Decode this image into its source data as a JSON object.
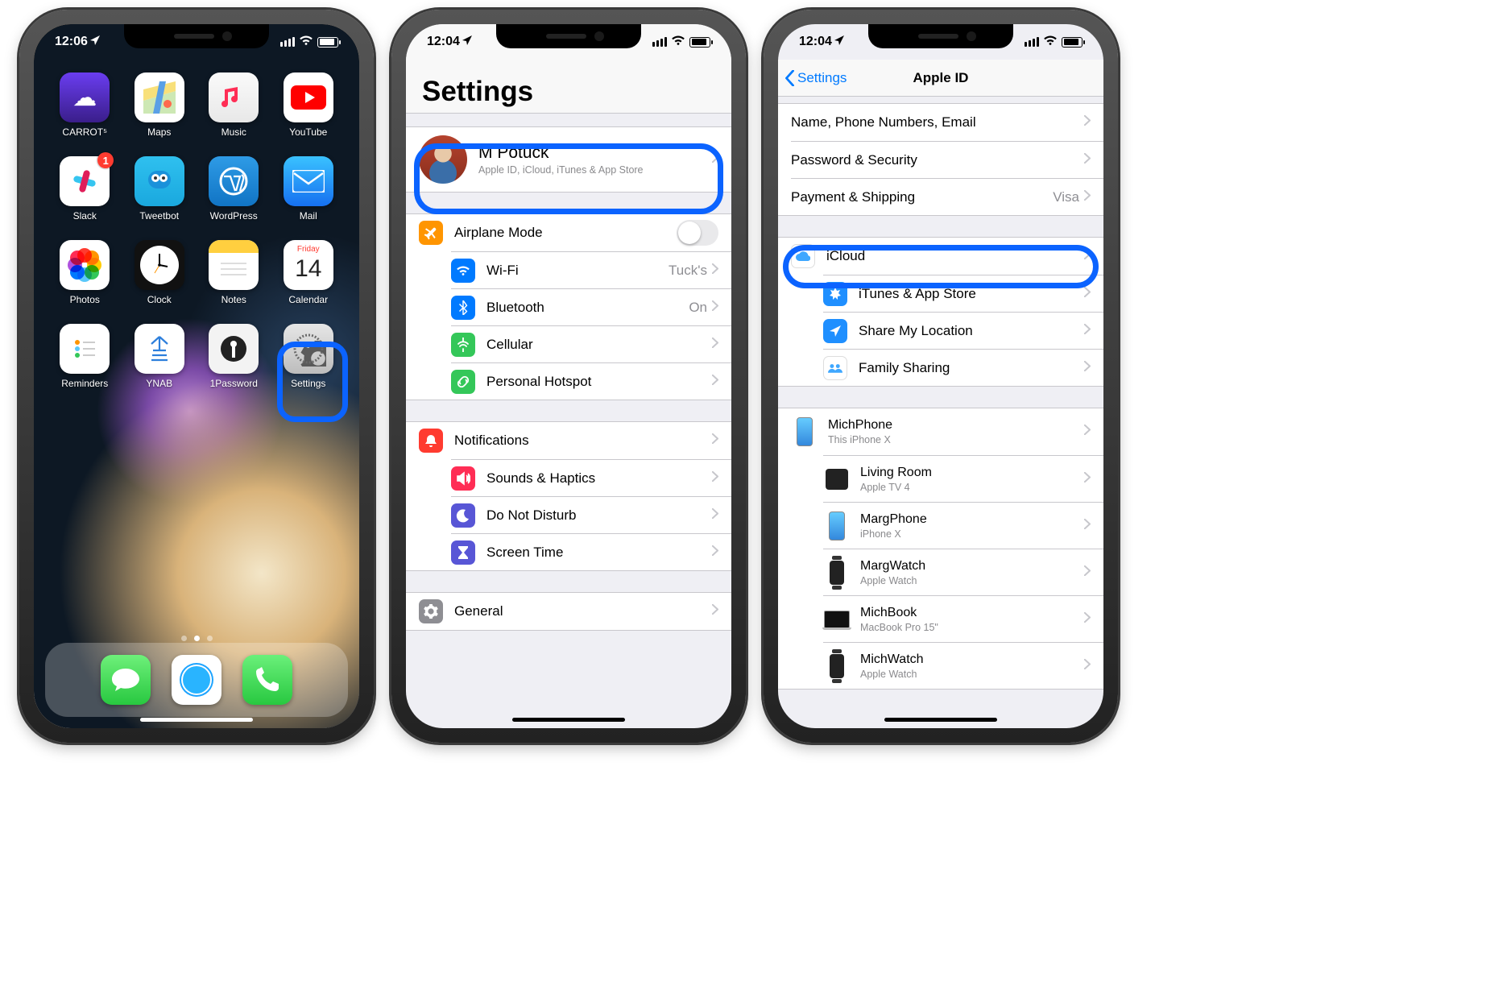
{
  "phone1": {
    "time": "12:06",
    "apps": [
      {
        "id": "carrot",
        "label": "CARROT⁵"
      },
      {
        "id": "maps",
        "label": "Maps"
      },
      {
        "id": "music",
        "label": "Music"
      },
      {
        "id": "youtube",
        "label": "YouTube"
      },
      {
        "id": "slack",
        "label": "Slack",
        "badge": "1"
      },
      {
        "id": "tweetbot",
        "label": "Tweetbot"
      },
      {
        "id": "wordpress",
        "label": "WordPress"
      },
      {
        "id": "mail",
        "label": "Mail"
      },
      {
        "id": "photos",
        "label": "Photos"
      },
      {
        "id": "clock",
        "label": "Clock"
      },
      {
        "id": "notes",
        "label": "Notes"
      },
      {
        "id": "calendar",
        "label": "Calendar",
        "weekday": "Friday",
        "day": "14"
      },
      {
        "id": "reminders",
        "label": "Reminders"
      },
      {
        "id": "ynab",
        "label": "YNAB"
      },
      {
        "id": "1password",
        "label": "1Password"
      },
      {
        "id": "settings",
        "label": "Settings"
      }
    ],
    "dock": [
      "messages",
      "safari",
      "phone"
    ]
  },
  "phone2": {
    "time": "12:04",
    "title": "Settings",
    "profile": {
      "name": "M Potuck",
      "subtitle": "Apple ID, iCloud, iTunes & App Store"
    },
    "group1": [
      {
        "icon": "airplane",
        "label": "Airplane Mode",
        "control": "switch"
      },
      {
        "icon": "wifi",
        "label": "Wi-Fi",
        "value": "Tuck's"
      },
      {
        "icon": "bt",
        "label": "Bluetooth",
        "value": "On"
      },
      {
        "icon": "cell",
        "label": "Cellular"
      },
      {
        "icon": "hotspot",
        "label": "Personal Hotspot"
      }
    ],
    "group2": [
      {
        "icon": "notif",
        "label": "Notifications"
      },
      {
        "icon": "sound",
        "label": "Sounds & Haptics"
      },
      {
        "icon": "dnd",
        "label": "Do Not Disturb"
      },
      {
        "icon": "screentime",
        "label": "Screen Time"
      }
    ],
    "group3": [
      {
        "icon": "general",
        "label": "General"
      }
    ]
  },
  "phone3": {
    "time": "12:04",
    "back": "Settings",
    "title": "Apple ID",
    "group1": [
      {
        "label": "Name, Phone Numbers, Email"
      },
      {
        "label": "Password & Security"
      },
      {
        "label": "Payment & Shipping",
        "value": "Visa"
      }
    ],
    "group2": [
      {
        "icon": "icloud",
        "label": "iCloud"
      },
      {
        "icon": "itunes",
        "label": "iTunes & App Store"
      },
      {
        "icon": "share",
        "label": "Share My Location"
      },
      {
        "icon": "family",
        "label": "Family Sharing"
      }
    ],
    "devices": [
      {
        "kind": "phone",
        "name": "MichPhone",
        "model": "This iPhone X"
      },
      {
        "kind": "atv",
        "name": "Living Room",
        "model": "Apple TV 4"
      },
      {
        "kind": "phone",
        "name": "MargPhone",
        "model": "iPhone X"
      },
      {
        "kind": "watch",
        "name": "MargWatch",
        "model": "Apple Watch"
      },
      {
        "kind": "mac",
        "name": "MichBook",
        "model": "MacBook Pro 15\""
      },
      {
        "kind": "watch",
        "name": "MichWatch",
        "model": "Apple Watch"
      }
    ]
  }
}
